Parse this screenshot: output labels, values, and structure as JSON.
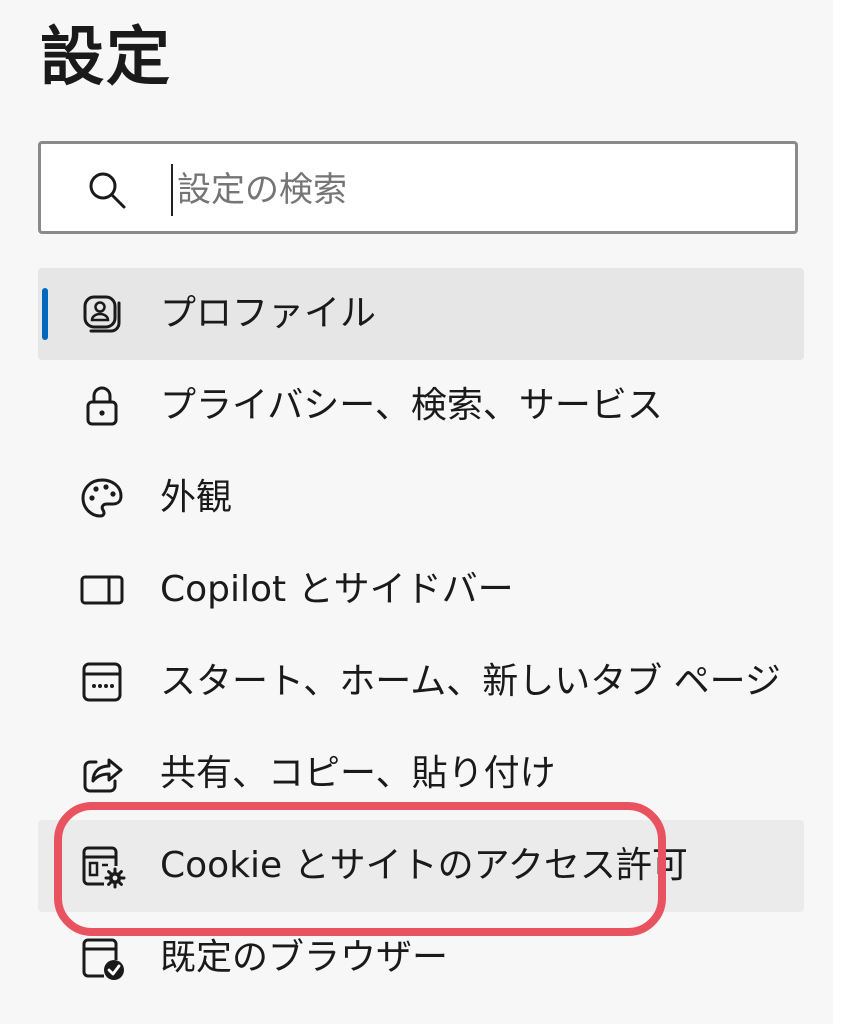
{
  "header": {
    "title": "設定"
  },
  "search": {
    "placeholder": "設定の検索"
  },
  "sidebar": {
    "accent_color": "#0067c0",
    "highlight_color": "#e8535f",
    "items": [
      {
        "label": "プロファイル",
        "icon": "profile-icon",
        "selected": true
      },
      {
        "label": "プライバシー、検索、サービス",
        "icon": "lock-icon"
      },
      {
        "label": "外観",
        "icon": "palette-icon"
      },
      {
        "label": "Copilot とサイドバー",
        "icon": "sidebar-icon"
      },
      {
        "label": "スタート、ホーム、新しいタブ ページ",
        "icon": "new-tab-page-icon"
      },
      {
        "label": "共有、コピー、貼り付け",
        "icon": "share-icon"
      },
      {
        "label": "Cookie とサイトのアクセス許可",
        "icon": "site-permissions-icon",
        "hovered": true,
        "highlighted": true
      },
      {
        "label": "既定のブラウザー",
        "icon": "default-browser-icon"
      }
    ]
  }
}
